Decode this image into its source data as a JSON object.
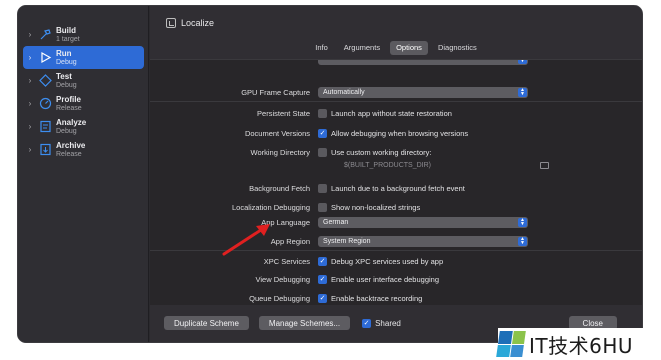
{
  "window": {
    "title": "Localize"
  },
  "sidebar": {
    "items": [
      {
        "title": "Build",
        "subtitle": "1 target",
        "icon": "hammer-icon"
      },
      {
        "title": "Run",
        "subtitle": "Debug",
        "icon": "play-icon",
        "active": true
      },
      {
        "title": "Test",
        "subtitle": "Debug",
        "icon": "wrench-icon"
      },
      {
        "title": "Profile",
        "subtitle": "Release",
        "icon": "gauge-icon"
      },
      {
        "title": "Analyze",
        "subtitle": "Debug",
        "icon": "analyze-icon"
      },
      {
        "title": "Archive",
        "subtitle": "Release",
        "icon": "archive-icon"
      }
    ]
  },
  "tabs": [
    {
      "label": "Info"
    },
    {
      "label": "Arguments"
    },
    {
      "label": "Options",
      "active": true
    },
    {
      "label": "Diagnostics"
    }
  ],
  "form": {
    "gpu_capture": {
      "label": "GPU Frame Capture",
      "value": "Automatically"
    },
    "persistent_state": {
      "label": "Persistent State",
      "option": "Launch app without state restoration",
      "checked": false
    },
    "document_versions": {
      "label": "Document Versions",
      "option": "Allow debugging when browsing versions",
      "checked": true
    },
    "working_directory": {
      "label": "Working Directory",
      "option": "Use custom working directory:",
      "checked": false,
      "path_placeholder": "$(BUILT_PRODUCTS_DIR)"
    },
    "background_fetch": {
      "label": "Background Fetch",
      "option": "Launch due to a background fetch event",
      "checked": false
    },
    "localization_debugging": {
      "label": "Localization Debugging",
      "option": "Show non-localized strings",
      "checked": false
    },
    "app_language": {
      "label": "App Language",
      "value": "German"
    },
    "app_region": {
      "label": "App Region",
      "value": "System Region"
    },
    "xpc_services": {
      "label": "XPC Services",
      "option": "Debug XPC services used by app",
      "checked": true
    },
    "view_debugging": {
      "label": "View Debugging",
      "option": "Enable user interface debugging",
      "checked": true
    },
    "queue_debugging": {
      "label": "Queue Debugging",
      "option": "Enable backtrace recording",
      "checked": true
    }
  },
  "footer": {
    "duplicate_label": "Duplicate Scheme",
    "manage_label": "Manage Schemes...",
    "shared_label": "Shared",
    "shared_checked": true,
    "close_label": "Close"
  },
  "watermark": {
    "text": "IT技术6HU"
  },
  "colors": {
    "accent": "#2e6bd6",
    "annotation_arrow": "#e02020"
  }
}
